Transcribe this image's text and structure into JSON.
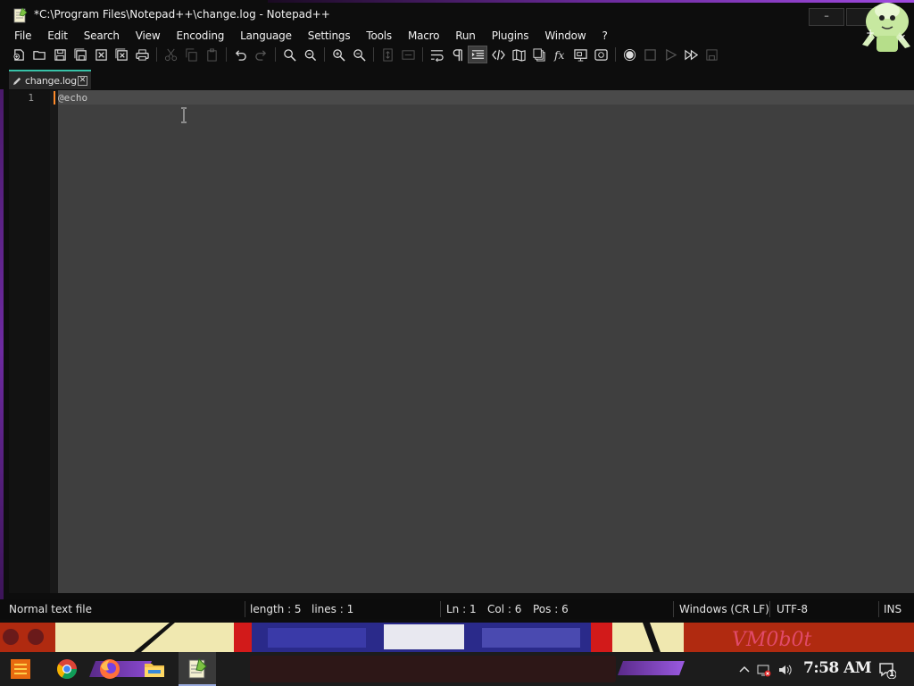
{
  "window": {
    "title": "*C:\\Program Files\\Notepad++\\change.log - Notepad++",
    "minimize_label": "–",
    "maximize_label": "",
    "close_label": "✕"
  },
  "menu": {
    "items": [
      "File",
      "Edit",
      "Search",
      "View",
      "Encoding",
      "Language",
      "Settings",
      "Tools",
      "Macro",
      "Run",
      "Plugins",
      "Window",
      "?"
    ],
    "plus": "+",
    "close": "✕"
  },
  "toolbar": {
    "buttons": [
      {
        "name": "new-file-icon",
        "enabled": true
      },
      {
        "name": "open-file-icon",
        "enabled": true
      },
      {
        "name": "save-icon",
        "enabled": true
      },
      {
        "name": "save-all-icon",
        "enabled": true
      },
      {
        "name": "close-icon",
        "enabled": true
      },
      {
        "name": "close-all-icon",
        "enabled": true
      },
      {
        "name": "print-icon",
        "enabled": true
      },
      {
        "name": "cut-icon",
        "enabled": false
      },
      {
        "name": "copy-icon",
        "enabled": false
      },
      {
        "name": "paste-icon",
        "enabled": false
      },
      {
        "name": "undo-icon",
        "enabled": true
      },
      {
        "name": "redo-icon",
        "enabled": false
      },
      {
        "name": "find-icon",
        "enabled": true
      },
      {
        "name": "replace-icon",
        "enabled": true
      },
      {
        "name": "zoom-in-icon",
        "enabled": true
      },
      {
        "name": "zoom-out-icon",
        "enabled": true
      },
      {
        "name": "sync-vertical-icon",
        "enabled": false
      },
      {
        "name": "sync-horizontal-icon",
        "enabled": false
      },
      {
        "name": "word-wrap-icon",
        "enabled": true
      },
      {
        "name": "show-all-characters-icon",
        "enabled": true
      },
      {
        "name": "indent-guide-icon",
        "enabled": true,
        "active": true
      },
      {
        "name": "user-defined-language-icon",
        "enabled": true
      },
      {
        "name": "document-map-icon",
        "enabled": true
      },
      {
        "name": "document-list-icon",
        "enabled": true
      },
      {
        "name": "function-list-icon",
        "enabled": true
      },
      {
        "name": "folder-as-workspace-icon",
        "enabled": true
      },
      {
        "name": "monitoring-icon",
        "enabled": true
      },
      {
        "name": "record-macro-icon",
        "enabled": true
      },
      {
        "name": "stop-macro-icon",
        "enabled": false
      },
      {
        "name": "play-macro-icon",
        "enabled": false
      },
      {
        "name": "run-macro-multiple-icon",
        "enabled": true
      },
      {
        "name": "save-macro-icon",
        "enabled": false
      }
    ]
  },
  "tab": {
    "label": "change.log",
    "close_label": "✕"
  },
  "editor": {
    "line_numbers": [
      "1"
    ],
    "lines": [
      "@echo"
    ]
  },
  "status": {
    "file_type": "Normal text file",
    "length": "length : 5",
    "lines": "lines : 1",
    "ln": "Ln : 1",
    "col": "Col : 6",
    "pos": "Pos : 6",
    "eol": "Windows (CR LF)",
    "encoding": "UTF-8",
    "mode": "INS"
  },
  "taskbar": {
    "apps": [
      "start-icon",
      "chrome-icon",
      "firefox-icon",
      "file-explorer-icon",
      "notepad-plus-plus-icon"
    ],
    "clock": "7:58 AM",
    "notification_count": "1"
  },
  "colors": {
    "editor_bg": "#3f3f3f",
    "gutter_bg": "#121212",
    "tab_accent": "#37c2a8",
    "caret_marker": "#ff8a2a",
    "frame_accent": "#6d2aa0"
  }
}
